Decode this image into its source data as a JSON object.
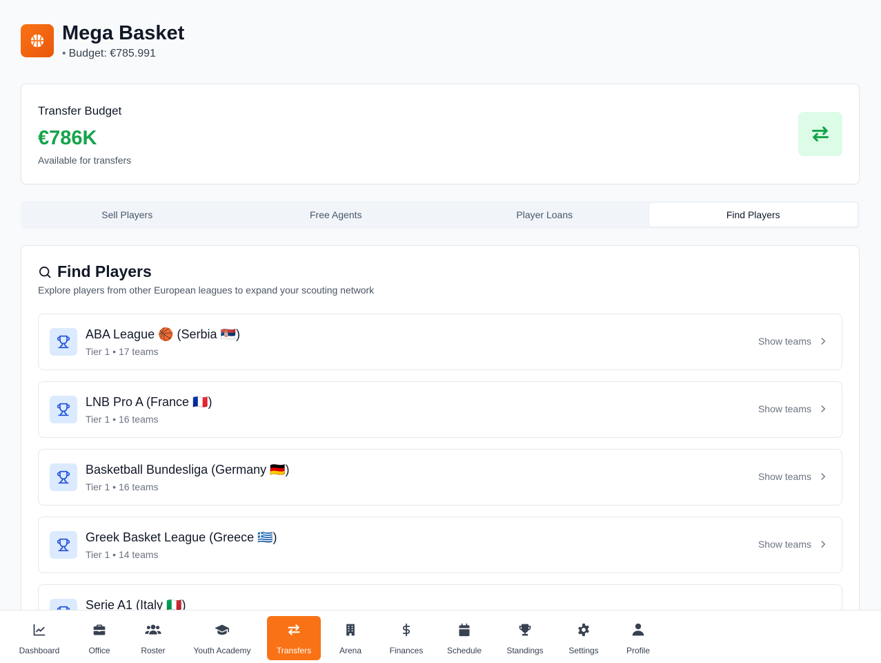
{
  "app": {
    "title": "Mega Basket",
    "budget_line": "Budget: €785.991"
  },
  "transfer_budget": {
    "label": "Transfer Budget",
    "amount": "€786K",
    "subtitle": "Available for transfers"
  },
  "tabs": [
    {
      "label": "Sell Players",
      "active": false
    },
    {
      "label": "Free Agents",
      "active": false
    },
    {
      "label": "Player Loans",
      "active": false
    },
    {
      "label": "Find Players",
      "active": true
    }
  ],
  "find_players": {
    "title": "Find Players",
    "subtitle": "Explore players from other European leagues to expand your scouting network",
    "show_label": "Show teams",
    "leagues": [
      {
        "name": "ABA League 🏀 (Serbia 🇷🇸)",
        "meta": "Tier 1 • 17 teams"
      },
      {
        "name": "LNB Pro A (France 🇫🇷)",
        "meta": "Tier 1 • 16 teams"
      },
      {
        "name": "Basketball Bundesliga (Germany 🇩🇪)",
        "meta": "Tier 1 • 16 teams"
      },
      {
        "name": "Greek Basket League (Greece 🇬🇷)",
        "meta": "Tier 1 • 14 teams"
      },
      {
        "name": "Serie A1 (Italy 🇮🇹)",
        "meta": ""
      }
    ]
  },
  "nav": [
    {
      "label": "Dashboard",
      "icon": "chart-line-icon"
    },
    {
      "label": "Office",
      "icon": "briefcase-icon"
    },
    {
      "label": "Roster",
      "icon": "users-icon"
    },
    {
      "label": "Youth Academy",
      "icon": "graduation-cap-icon"
    },
    {
      "label": "Transfers",
      "icon": "arrows-exchange-icon",
      "active": true
    },
    {
      "label": "Arena",
      "icon": "building-icon"
    },
    {
      "label": "Finances",
      "icon": "dollar-icon"
    },
    {
      "label": "Schedule",
      "icon": "calendar-icon"
    },
    {
      "label": "Standings",
      "icon": "trophy-icon"
    },
    {
      "label": "Settings",
      "icon": "gear-icon"
    },
    {
      "label": "Profile",
      "icon": "user-icon"
    }
  ],
  "colors": {
    "accent": "#f97316",
    "money": "#16a34a",
    "icon_blue": "#1d4ed8"
  }
}
